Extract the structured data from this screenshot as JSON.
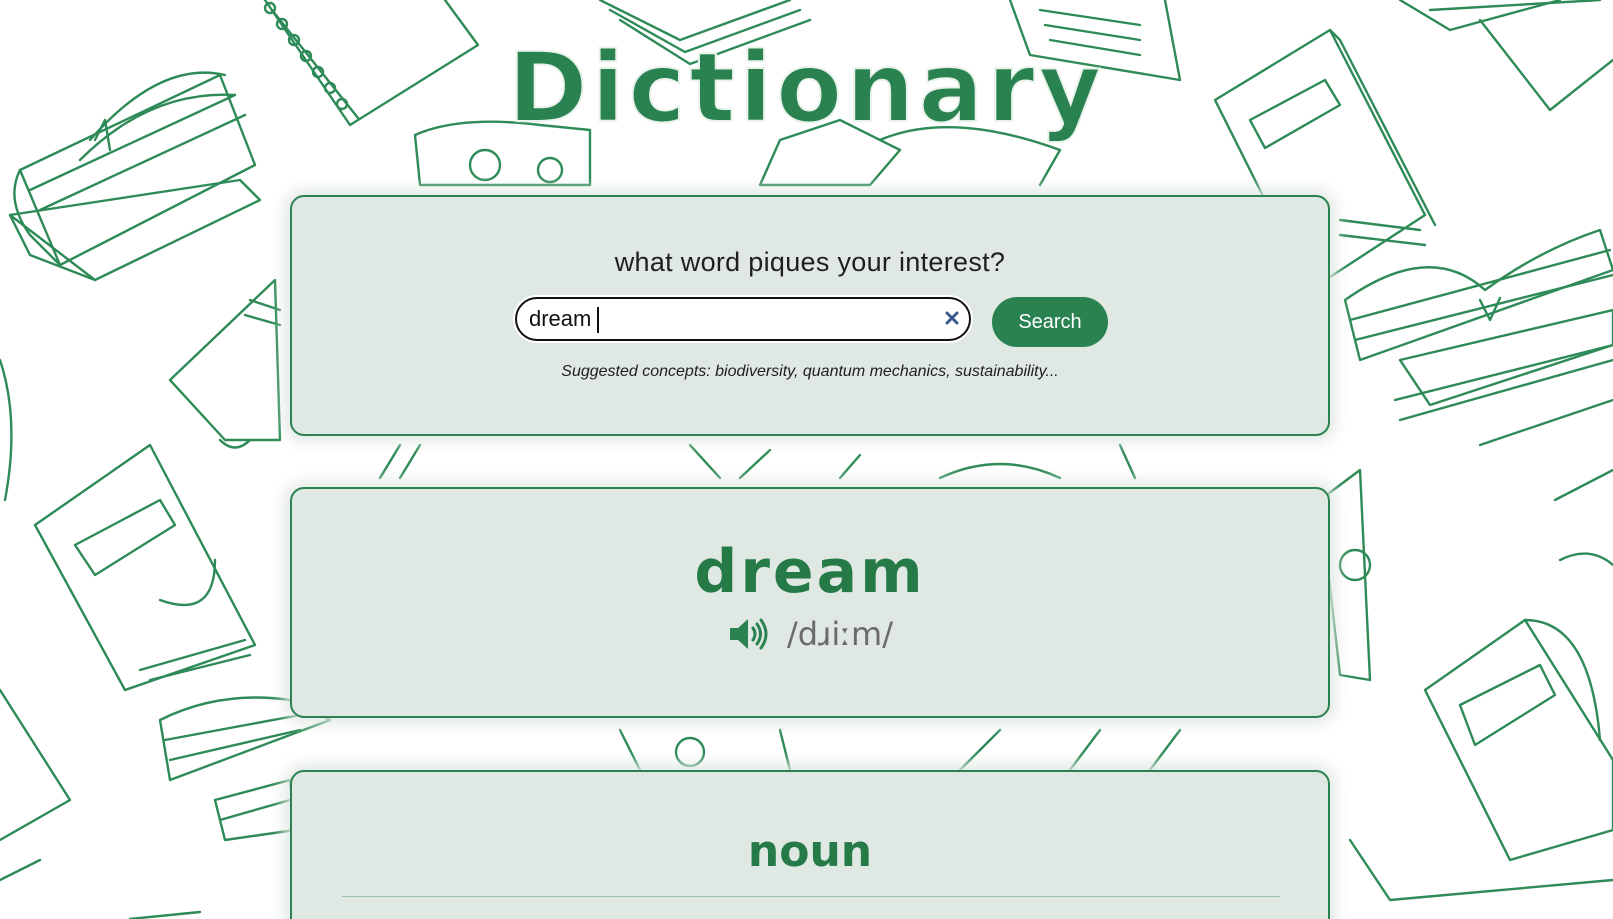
{
  "app": {
    "title": "Dictionary"
  },
  "search": {
    "prompt": "what word piques your interest?",
    "value": "dream",
    "placeholder": "",
    "button_label": "Search",
    "suggestions": "Suggested concepts: biodiversity, quantum mechanics, sustainability...",
    "clear_icon": "close-icon"
  },
  "entry": {
    "word": "dream",
    "phonetic": "/dɹiːm/",
    "audio_icon": "speaker-icon"
  },
  "meanings": [
    {
      "part_of_speech": "noun"
    }
  ],
  "colors": {
    "accent": "#2a8250",
    "card_bg": "#dfe8e3",
    "doodle": "#2e8b57",
    "clear_icon": "#3a5a8c"
  }
}
